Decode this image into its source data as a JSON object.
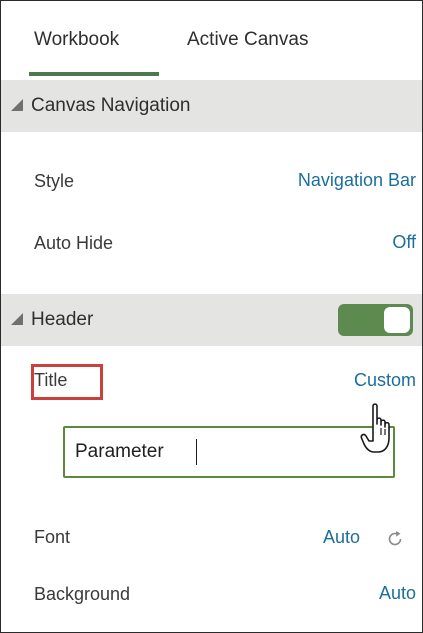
{
  "tabs": [
    {
      "label": "Workbook",
      "active": true
    },
    {
      "label": "Active Canvas",
      "active": false
    }
  ],
  "canvas_navigation": {
    "title": "Canvas Navigation",
    "rows": [
      {
        "label": "Style",
        "value": "Navigation Bar"
      },
      {
        "label": "Auto Hide",
        "value": "Off"
      }
    ]
  },
  "header": {
    "title": "Header",
    "toggle_on": true,
    "rows": [
      {
        "label": "Title",
        "value": "Custom"
      },
      {
        "label": "Font",
        "value": "Auto"
      },
      {
        "label": "Background",
        "value": "Auto"
      }
    ],
    "title_input_value": "Parameter"
  },
  "icons": {
    "collapse": "triangle-collapse-icon",
    "refresh": "refresh-icon",
    "cursor": "hand-pointer-cursor"
  },
  "colors": {
    "accent_green": "#5c8a4f",
    "link_blue": "#1b6f9a",
    "highlight_red": "#c9413a",
    "section_bg": "#e4e4e2"
  }
}
